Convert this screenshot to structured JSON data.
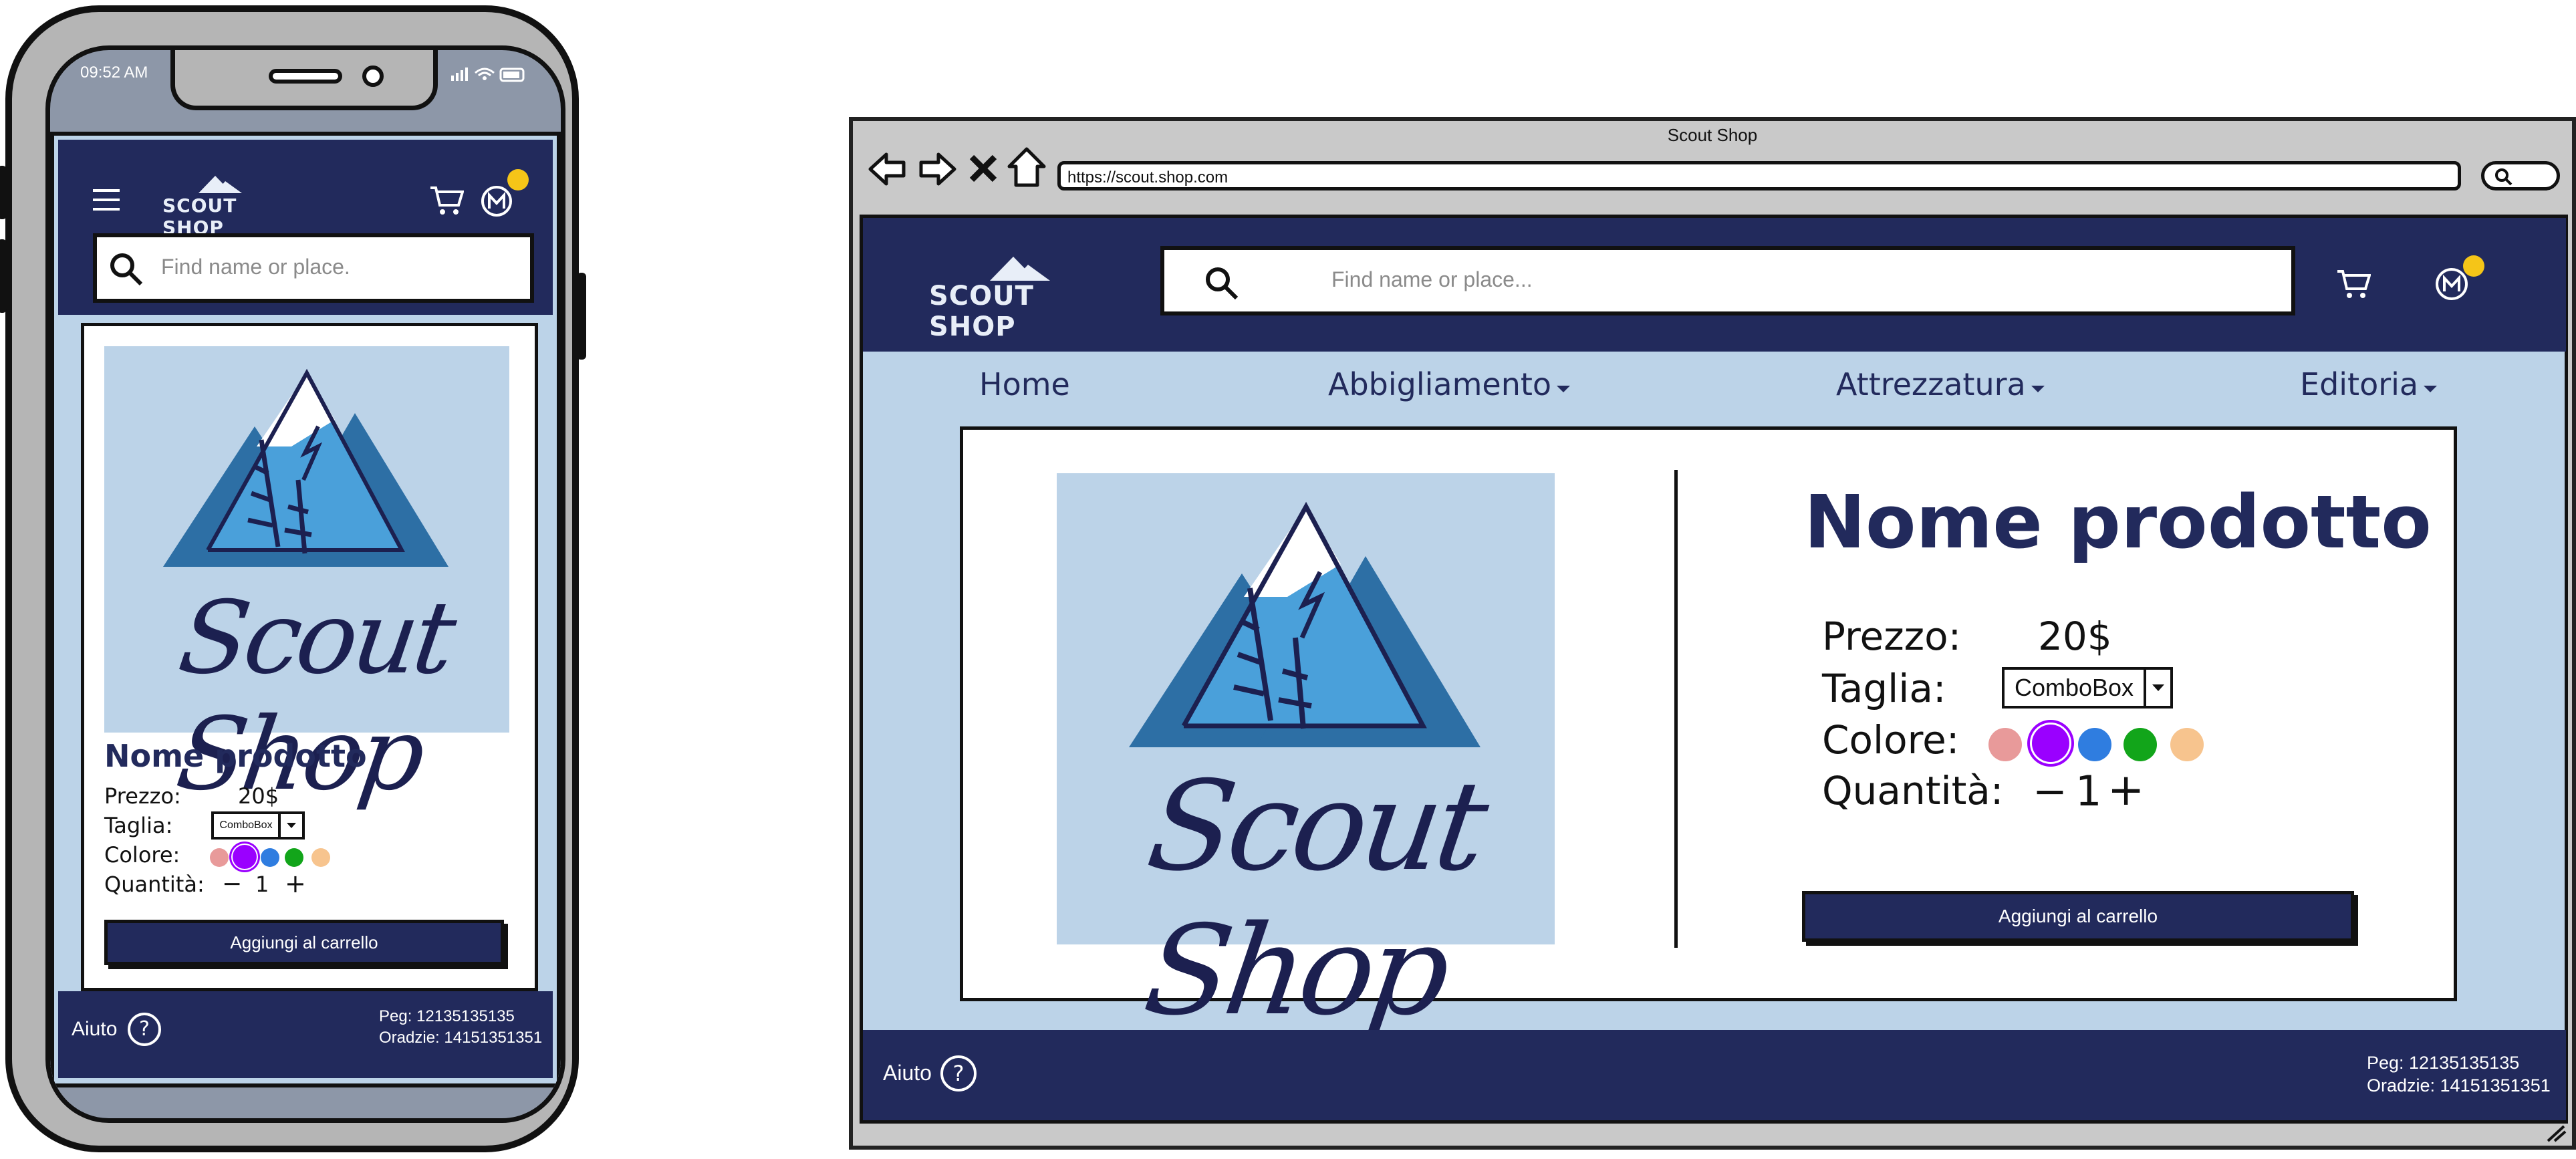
{
  "brand": {
    "name": "SCOUT SHOP",
    "image_caption": "Scout Shop",
    "colors": {
      "navy": "#222a5c",
      "light_blue": "#bcd3e8",
      "badge": "#f5c518"
    }
  },
  "mobile": {
    "status_time": "09:52 AM",
    "search_placeholder": "Find name or place.",
    "product": {
      "title": "Nome prodotto",
      "price_label": "Prezzo:",
      "price_value": "20$",
      "size_label": "Taglia:",
      "size_value": "ComboBox",
      "color_label": "Colore:",
      "quantity_label": "Quantità:",
      "quantity_minus": "−",
      "quantity_value": "1",
      "quantity_plus": "+",
      "add_button": "Aggiungi al carrello"
    },
    "footer": {
      "help": "Aiuto",
      "help_icon": "?",
      "line1": "Peg: 12135135135",
      "line2": "Oradzie: 14151351351"
    }
  },
  "desktop": {
    "window_title": "Scout Shop",
    "url": "https://scout.shop.com",
    "search_placeholder": "Find name or place...",
    "nav": [
      {
        "label": "Home",
        "dropdown": false
      },
      {
        "label": "Abbigliamento",
        "dropdown": true
      },
      {
        "label": "Attrezzatura",
        "dropdown": true
      },
      {
        "label": "Editoria",
        "dropdown": true
      }
    ],
    "product": {
      "title": "Nome prodotto",
      "price_label": "Prezzo:",
      "price_value": "20$",
      "size_label": "Taglia:",
      "size_value": "ComboBox",
      "color_label": "Colore:",
      "quantity_label": "Quantità:",
      "quantity_minus": "−",
      "quantity_value": "1",
      "quantity_plus": "+",
      "add_button": "Aggiungi al carrello"
    },
    "footer": {
      "help": "Aiuto",
      "help_icon": "?",
      "line1": "Peg: 12135135135",
      "line2": "Oradzie: 14151351351"
    }
  },
  "color_swatches": [
    {
      "name": "pink",
      "hex": "#e89a9a",
      "selected": false
    },
    {
      "name": "purple",
      "hex": "#9a00ff",
      "selected": true
    },
    {
      "name": "blue",
      "hex": "#2f7de0",
      "selected": false
    },
    {
      "name": "green",
      "hex": "#12a51a",
      "selected": false
    },
    {
      "name": "peach",
      "hex": "#f7c48e",
      "selected": false
    }
  ],
  "icons": [
    "menu-icon",
    "cart-icon",
    "account-icon",
    "search-icon",
    "help-icon",
    "back-icon",
    "forward-icon",
    "close-icon",
    "home-icon",
    "dropdown-arrow-icon",
    "resize-grip-icon"
  ]
}
